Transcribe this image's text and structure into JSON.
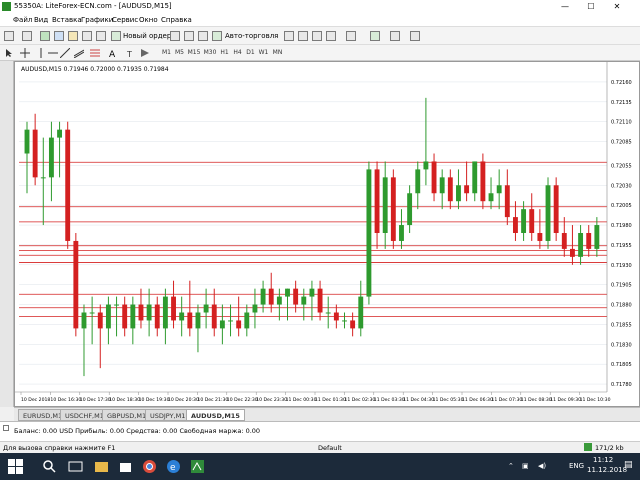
{
  "window": {
    "title": "55350A: LiteForex-ECN.com - [AUDUSD,M15]",
    "minimize": "—",
    "maximize": "☐",
    "close": "✕"
  },
  "menu": [
    "Файл",
    "Вид",
    "Вставка",
    "Графики",
    "Сервис",
    "Окно",
    "Справка"
  ],
  "toolbar": {
    "new_order": "Новый ордер",
    "auto_trading": "Авто-торговля",
    "timeframes": [
      "M1",
      "M5",
      "M15",
      "M30",
      "H1",
      "H4",
      "D1",
      "W1",
      "MN"
    ]
  },
  "chart": {
    "header": "AUDUSD,M15  0.71946 0.72000 0.71935 0.71984",
    "symbol": "AUDUSD",
    "colors": {
      "bull": "#2e9a2e",
      "bear": "#d42020",
      "level": "#d42020",
      "grid": "#dde3ea"
    },
    "price_labels": [
      "0.72160",
      "0.72135",
      "0.72110",
      "0.72085",
      "0.72055",
      "0.72030",
      "0.72005",
      "0.71980",
      "0.71955",
      "0.71930",
      "0.71905",
      "0.71880",
      "0.71855",
      "0.71830",
      "0.71805",
      "0.71780"
    ],
    "level_labels": [
      "0.72059",
      "0.72003",
      "0.71984",
      "0.71954",
      "0.71948",
      "0.71942",
      "0.71933",
      "0.71893",
      "0.71876",
      "0.71865"
    ],
    "time_labels": [
      "10 Dec 2018",
      "10 Dec 16:30",
      "10 Dec 17:30",
      "10 Dec 18:30",
      "10 Dec 19:30",
      "10 Dec 20:30",
      "10 Dec 21:30",
      "10 Dec 22:30",
      "10 Dec 23:30",
      "11 Dec 00:30",
      "11 Dec 01:30",
      "11 Dec 02:30",
      "11 Dec 03:30",
      "11 Dec 04:30",
      "11 Dec 05:30",
      "11 Dec 06:30",
      "11 Dec 07:30",
      "11 Dec 08:30",
      "11 Dec 09:30",
      "11 Dec 10:30"
    ]
  },
  "chart_data": {
    "type": "candlestick",
    "symbol": "AUDUSD",
    "timeframe": "M15",
    "ylim": [
      0.7177,
      0.7217
    ],
    "candles": [
      {
        "o": 0.7207,
        "h": 0.7211,
        "l": 0.7202,
        "c": 0.721
      },
      {
        "o": 0.721,
        "h": 0.7212,
        "l": 0.7203,
        "c": 0.7204
      },
      {
        "o": 0.7204,
        "h": 0.7209,
        "l": 0.7198,
        "c": 0.7204
      },
      {
        "o": 0.7204,
        "h": 0.7211,
        "l": 0.7201,
        "c": 0.7209
      },
      {
        "o": 0.7209,
        "h": 0.7211,
        "l": 0.7204,
        "c": 0.721
      },
      {
        "o": 0.721,
        "h": 0.7211,
        "l": 0.7195,
        "c": 0.7196
      },
      {
        "o": 0.7196,
        "h": 0.7197,
        "l": 0.7184,
        "c": 0.7185
      },
      {
        "o": 0.7185,
        "h": 0.7188,
        "l": 0.7179,
        "c": 0.7187
      },
      {
        "o": 0.7187,
        "h": 0.7189,
        "l": 0.7183,
        "c": 0.7187
      },
      {
        "o": 0.7187,
        "h": 0.7188,
        "l": 0.718,
        "c": 0.7185
      },
      {
        "o": 0.7185,
        "h": 0.7189,
        "l": 0.7183,
        "c": 0.7188
      },
      {
        "o": 0.7188,
        "h": 0.7189,
        "l": 0.7184,
        "c": 0.7188
      },
      {
        "o": 0.7188,
        "h": 0.7189,
        "l": 0.7184,
        "c": 0.7185
      },
      {
        "o": 0.7185,
        "h": 0.7189,
        "l": 0.7183,
        "c": 0.7188
      },
      {
        "o": 0.7188,
        "h": 0.719,
        "l": 0.7185,
        "c": 0.7186
      },
      {
        "o": 0.7186,
        "h": 0.719,
        "l": 0.7184,
        "c": 0.7188
      },
      {
        "o": 0.7188,
        "h": 0.7189,
        "l": 0.7184,
        "c": 0.7185
      },
      {
        "o": 0.7185,
        "h": 0.719,
        "l": 0.7183,
        "c": 0.7189
      },
      {
        "o": 0.7189,
        "h": 0.7191,
        "l": 0.7185,
        "c": 0.7186
      },
      {
        "o": 0.7186,
        "h": 0.7189,
        "l": 0.7184,
        "c": 0.7187
      },
      {
        "o": 0.7187,
        "h": 0.7191,
        "l": 0.7184,
        "c": 0.7185
      },
      {
        "o": 0.7185,
        "h": 0.7188,
        "l": 0.7182,
        "c": 0.7187
      },
      {
        "o": 0.7187,
        "h": 0.719,
        "l": 0.7185,
        "c": 0.7188
      },
      {
        "o": 0.7188,
        "h": 0.719,
        "l": 0.7184,
        "c": 0.7185
      },
      {
        "o": 0.7185,
        "h": 0.7188,
        "l": 0.7183,
        "c": 0.7186
      },
      {
        "o": 0.7186,
        "h": 0.7188,
        "l": 0.7184,
        "c": 0.7186
      },
      {
        "o": 0.7186,
        "h": 0.7189,
        "l": 0.7184,
        "c": 0.7185
      },
      {
        "o": 0.7185,
        "h": 0.7188,
        "l": 0.7184,
        "c": 0.7187
      },
      {
        "o": 0.7187,
        "h": 0.719,
        "l": 0.7185,
        "c": 0.7188
      },
      {
        "o": 0.7188,
        "h": 0.7191,
        "l": 0.7187,
        "c": 0.719
      },
      {
        "o": 0.719,
        "h": 0.7192,
        "l": 0.7187,
        "c": 0.7188
      },
      {
        "o": 0.7188,
        "h": 0.719,
        "l": 0.7186,
        "c": 0.7189
      },
      {
        "o": 0.7189,
        "h": 0.719,
        "l": 0.7186,
        "c": 0.719
      },
      {
        "o": 0.719,
        "h": 0.7191,
        "l": 0.7187,
        "c": 0.7188
      },
      {
        "o": 0.7188,
        "h": 0.719,
        "l": 0.7186,
        "c": 0.7189
      },
      {
        "o": 0.7189,
        "h": 0.7191,
        "l": 0.7186,
        "c": 0.719
      },
      {
        "o": 0.719,
        "h": 0.7191,
        "l": 0.7186,
        "c": 0.7187
      },
      {
        "o": 0.7187,
        "h": 0.7189,
        "l": 0.7185,
        "c": 0.7187
      },
      {
        "o": 0.7187,
        "h": 0.7188,
        "l": 0.7185,
        "c": 0.7186
      },
      {
        "o": 0.7186,
        "h": 0.7187,
        "l": 0.7185,
        "c": 0.7186
      },
      {
        "o": 0.7186,
        "h": 0.7187,
        "l": 0.7184,
        "c": 0.7185
      },
      {
        "o": 0.7185,
        "h": 0.7191,
        "l": 0.7184,
        "c": 0.7189
      },
      {
        "o": 0.7189,
        "h": 0.7206,
        "l": 0.7188,
        "c": 0.7205
      },
      {
        "o": 0.7205,
        "h": 0.7206,
        "l": 0.7195,
        "c": 0.7197
      },
      {
        "o": 0.7197,
        "h": 0.7206,
        "l": 0.7195,
        "c": 0.7204
      },
      {
        "o": 0.7204,
        "h": 0.7205,
        "l": 0.7195,
        "c": 0.7196
      },
      {
        "o": 0.7196,
        "h": 0.72,
        "l": 0.7195,
        "c": 0.7198
      },
      {
        "o": 0.7198,
        "h": 0.7203,
        "l": 0.7197,
        "c": 0.7202
      },
      {
        "o": 0.7202,
        "h": 0.7206,
        "l": 0.72,
        "c": 0.7205
      },
      {
        "o": 0.7205,
        "h": 0.7214,
        "l": 0.7203,
        "c": 0.7206
      },
      {
        "o": 0.7206,
        "h": 0.7207,
        "l": 0.7201,
        "c": 0.7202
      },
      {
        "o": 0.7202,
        "h": 0.7205,
        "l": 0.72,
        "c": 0.7204
      },
      {
        "o": 0.7204,
        "h": 0.7205,
        "l": 0.72,
        "c": 0.7201
      },
      {
        "o": 0.7201,
        "h": 0.7205,
        "l": 0.72,
        "c": 0.7203
      },
      {
        "o": 0.7203,
        "h": 0.7206,
        "l": 0.7201,
        "c": 0.7202
      },
      {
        "o": 0.7202,
        "h": 0.7206,
        "l": 0.7201,
        "c": 0.7206
      },
      {
        "o": 0.7206,
        "h": 0.7207,
        "l": 0.72,
        "c": 0.7201
      },
      {
        "o": 0.7201,
        "h": 0.7204,
        "l": 0.72,
        "c": 0.7202
      },
      {
        "o": 0.7202,
        "h": 0.7205,
        "l": 0.72,
        "c": 0.7203
      },
      {
        "o": 0.7203,
        "h": 0.7205,
        "l": 0.7198,
        "c": 0.7199
      },
      {
        "o": 0.7199,
        "h": 0.7201,
        "l": 0.7196,
        "c": 0.7197
      },
      {
        "o": 0.7197,
        "h": 0.7201,
        "l": 0.7196,
        "c": 0.72
      },
      {
        "o": 0.72,
        "h": 0.7202,
        "l": 0.7196,
        "c": 0.7197
      },
      {
        "o": 0.7197,
        "h": 0.72,
        "l": 0.7195,
        "c": 0.7196
      },
      {
        "o": 0.7196,
        "h": 0.7204,
        "l": 0.7195,
        "c": 0.7203
      },
      {
        "o": 0.7203,
        "h": 0.7204,
        "l": 0.7196,
        "c": 0.7197
      },
      {
        "o": 0.7197,
        "h": 0.7199,
        "l": 0.7194,
        "c": 0.7195
      },
      {
        "o": 0.7195,
        "h": 0.7198,
        "l": 0.7193,
        "c": 0.7194
      },
      {
        "o": 0.7194,
        "h": 0.7198,
        "l": 0.7193,
        "c": 0.7197
      },
      {
        "o": 0.7197,
        "h": 0.7198,
        "l": 0.7194,
        "c": 0.7195
      },
      {
        "o": 0.7195,
        "h": 0.7199,
        "l": 0.7194,
        "c": 0.7198
      }
    ],
    "levels": [
      0.72059,
      0.72003,
      0.71984,
      0.71954,
      0.71948,
      0.71942,
      0.71933,
      0.71893,
      0.71876,
      0.71865
    ]
  },
  "tabs": [
    "EURUSD,M1",
    "USDCHF,M1",
    "GBPUSD,M1",
    "USDJPY,M1",
    "AUDUSD,M15"
  ],
  "active_tab": 4,
  "terminal": {
    "balance": "Баланс: 0.00 USD  Прибыль: 0.00  Средства: 0.00  Свободная маржа: 0.00"
  },
  "status": {
    "help": "Для вызова справки нажмите F1",
    "profile": "Default",
    "traffic": "171/2 kb"
  },
  "taskbar": {
    "time": "11:12",
    "date": "11.12.2018",
    "lang": "ENG"
  }
}
